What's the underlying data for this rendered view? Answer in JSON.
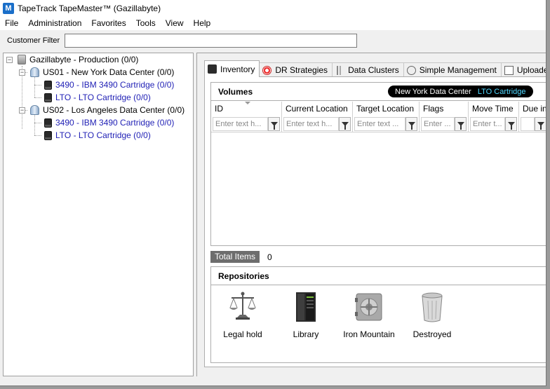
{
  "window": {
    "title": "TapeTrack TapeMaster™ (Gazillabyte)",
    "app_icon_glyph": "M"
  },
  "menu": {
    "items": [
      "File",
      "Administration",
      "Favorites",
      "Tools",
      "View",
      "Help"
    ]
  },
  "filter": {
    "label": "Customer Filter",
    "value": ""
  },
  "tree": {
    "root": {
      "label": "Gazillabyte - Production (0/0)",
      "icon": "server-icon"
    },
    "sites": [
      {
        "label": "US01 - New York Data Center (0/0)",
        "icon": "data-center-icon",
        "media": [
          {
            "label": "3490 - IBM 3490 Cartridge (0/0)",
            "icon": "cartridge-icon"
          },
          {
            "label": "LTO - LTO Cartridge (0/0)",
            "icon": "cartridge-icon"
          }
        ]
      },
      {
        "label": "US02 - Los Angeles Data Center (0/0)",
        "icon": "data-center-icon",
        "media": [
          {
            "label": "3490 - IBM 3490 Cartridge (0/0)",
            "icon": "cartridge-icon"
          },
          {
            "label": "LTO - LTO Cartridge (0/0)",
            "icon": "cartridge-icon"
          }
        ]
      }
    ],
    "colors": {
      "media_text": "#1f1fb5"
    }
  },
  "tabs": [
    {
      "label": "Inventory",
      "icon": "inventory-icon",
      "active": true
    },
    {
      "label": "DR Strategies",
      "icon": "lifebuoy-icon",
      "active": false
    },
    {
      "label": "Data Clusters",
      "icon": "clusters-icon",
      "active": false
    },
    {
      "label": "Simple Management",
      "icon": "simple-management-icon",
      "active": false
    },
    {
      "label": "Uploaded F",
      "icon": "upload-icon",
      "active": false
    }
  ],
  "volumes": {
    "title": "Volumes",
    "context_pill": {
      "location": "New York Data Center",
      "media": "LTO Cartridge",
      "accent": "#4fd7ff"
    },
    "columns": [
      {
        "title": "ID",
        "placeholder": "Enter text h..."
      },
      {
        "title": "Current Location",
        "placeholder": "Enter text h..."
      },
      {
        "title": "Target Location",
        "placeholder": "Enter text ..."
      },
      {
        "title": "Flags",
        "placeholder": "Enter ..."
      },
      {
        "title": "Move Time",
        "placeholder": "Enter t..."
      },
      {
        "title": "Due in",
        "placeholder": ""
      }
    ],
    "rows": [],
    "total_label": "Total Items",
    "total_value": "0"
  },
  "repositories": {
    "title": "Repositories",
    "items": [
      {
        "label": "Legal hold",
        "icon": "scales-icon"
      },
      {
        "label": "Library",
        "icon": "tape-library-icon"
      },
      {
        "label": "Iron Mountain",
        "icon": "vault-icon"
      },
      {
        "label": "Destroyed",
        "icon": "trash-can-icon"
      }
    ]
  }
}
